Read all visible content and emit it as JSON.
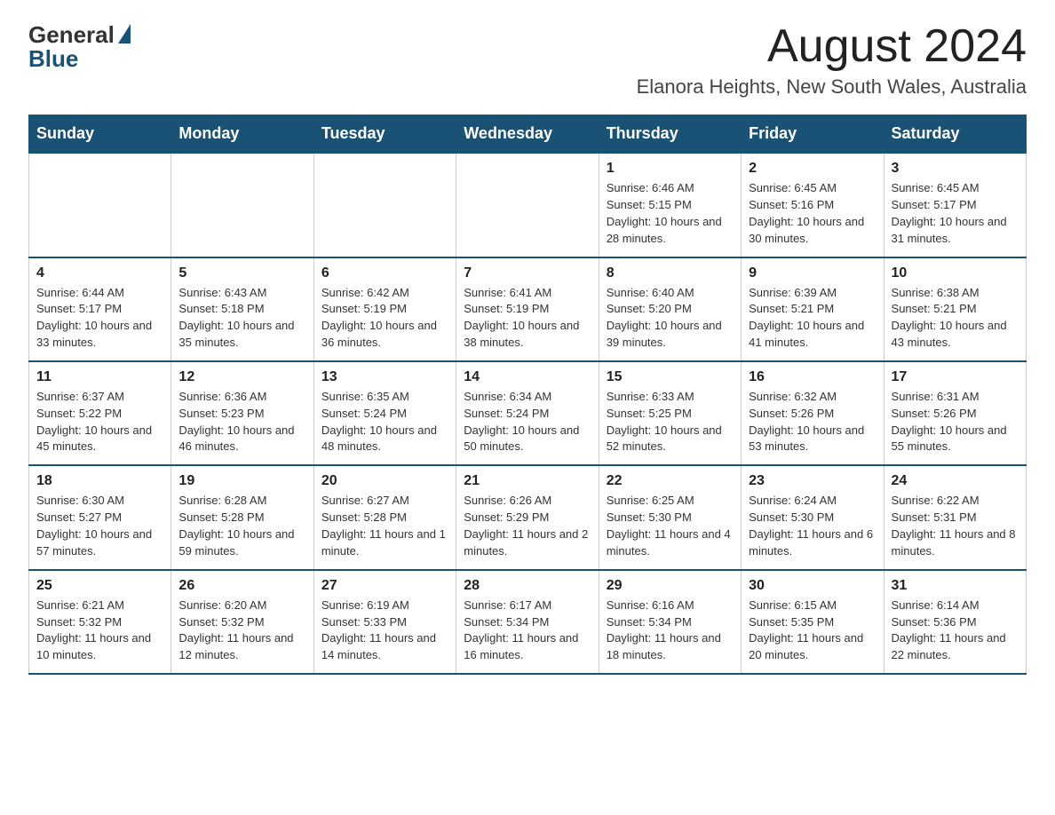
{
  "header": {
    "logo_general": "General",
    "logo_blue": "Blue",
    "month_title": "August 2024",
    "location": "Elanora Heights, New South Wales, Australia"
  },
  "days_of_week": [
    "Sunday",
    "Monday",
    "Tuesday",
    "Wednesday",
    "Thursday",
    "Friday",
    "Saturday"
  ],
  "weeks": [
    [
      {
        "day": "",
        "info": ""
      },
      {
        "day": "",
        "info": ""
      },
      {
        "day": "",
        "info": ""
      },
      {
        "day": "",
        "info": ""
      },
      {
        "day": "1",
        "info": "Sunrise: 6:46 AM\nSunset: 5:15 PM\nDaylight: 10 hours and 28 minutes."
      },
      {
        "day": "2",
        "info": "Sunrise: 6:45 AM\nSunset: 5:16 PM\nDaylight: 10 hours and 30 minutes."
      },
      {
        "day": "3",
        "info": "Sunrise: 6:45 AM\nSunset: 5:17 PM\nDaylight: 10 hours and 31 minutes."
      }
    ],
    [
      {
        "day": "4",
        "info": "Sunrise: 6:44 AM\nSunset: 5:17 PM\nDaylight: 10 hours and 33 minutes."
      },
      {
        "day": "5",
        "info": "Sunrise: 6:43 AM\nSunset: 5:18 PM\nDaylight: 10 hours and 35 minutes."
      },
      {
        "day": "6",
        "info": "Sunrise: 6:42 AM\nSunset: 5:19 PM\nDaylight: 10 hours and 36 minutes."
      },
      {
        "day": "7",
        "info": "Sunrise: 6:41 AM\nSunset: 5:19 PM\nDaylight: 10 hours and 38 minutes."
      },
      {
        "day": "8",
        "info": "Sunrise: 6:40 AM\nSunset: 5:20 PM\nDaylight: 10 hours and 39 minutes."
      },
      {
        "day": "9",
        "info": "Sunrise: 6:39 AM\nSunset: 5:21 PM\nDaylight: 10 hours and 41 minutes."
      },
      {
        "day": "10",
        "info": "Sunrise: 6:38 AM\nSunset: 5:21 PM\nDaylight: 10 hours and 43 minutes."
      }
    ],
    [
      {
        "day": "11",
        "info": "Sunrise: 6:37 AM\nSunset: 5:22 PM\nDaylight: 10 hours and 45 minutes."
      },
      {
        "day": "12",
        "info": "Sunrise: 6:36 AM\nSunset: 5:23 PM\nDaylight: 10 hours and 46 minutes."
      },
      {
        "day": "13",
        "info": "Sunrise: 6:35 AM\nSunset: 5:24 PM\nDaylight: 10 hours and 48 minutes."
      },
      {
        "day": "14",
        "info": "Sunrise: 6:34 AM\nSunset: 5:24 PM\nDaylight: 10 hours and 50 minutes."
      },
      {
        "day": "15",
        "info": "Sunrise: 6:33 AM\nSunset: 5:25 PM\nDaylight: 10 hours and 52 minutes."
      },
      {
        "day": "16",
        "info": "Sunrise: 6:32 AM\nSunset: 5:26 PM\nDaylight: 10 hours and 53 minutes."
      },
      {
        "day": "17",
        "info": "Sunrise: 6:31 AM\nSunset: 5:26 PM\nDaylight: 10 hours and 55 minutes."
      }
    ],
    [
      {
        "day": "18",
        "info": "Sunrise: 6:30 AM\nSunset: 5:27 PM\nDaylight: 10 hours and 57 minutes."
      },
      {
        "day": "19",
        "info": "Sunrise: 6:28 AM\nSunset: 5:28 PM\nDaylight: 10 hours and 59 minutes."
      },
      {
        "day": "20",
        "info": "Sunrise: 6:27 AM\nSunset: 5:28 PM\nDaylight: 11 hours and 1 minute."
      },
      {
        "day": "21",
        "info": "Sunrise: 6:26 AM\nSunset: 5:29 PM\nDaylight: 11 hours and 2 minutes."
      },
      {
        "day": "22",
        "info": "Sunrise: 6:25 AM\nSunset: 5:30 PM\nDaylight: 11 hours and 4 minutes."
      },
      {
        "day": "23",
        "info": "Sunrise: 6:24 AM\nSunset: 5:30 PM\nDaylight: 11 hours and 6 minutes."
      },
      {
        "day": "24",
        "info": "Sunrise: 6:22 AM\nSunset: 5:31 PM\nDaylight: 11 hours and 8 minutes."
      }
    ],
    [
      {
        "day": "25",
        "info": "Sunrise: 6:21 AM\nSunset: 5:32 PM\nDaylight: 11 hours and 10 minutes."
      },
      {
        "day": "26",
        "info": "Sunrise: 6:20 AM\nSunset: 5:32 PM\nDaylight: 11 hours and 12 minutes."
      },
      {
        "day": "27",
        "info": "Sunrise: 6:19 AM\nSunset: 5:33 PM\nDaylight: 11 hours and 14 minutes."
      },
      {
        "day": "28",
        "info": "Sunrise: 6:17 AM\nSunset: 5:34 PM\nDaylight: 11 hours and 16 minutes."
      },
      {
        "day": "29",
        "info": "Sunrise: 6:16 AM\nSunset: 5:34 PM\nDaylight: 11 hours and 18 minutes."
      },
      {
        "day": "30",
        "info": "Sunrise: 6:15 AM\nSunset: 5:35 PM\nDaylight: 11 hours and 20 minutes."
      },
      {
        "day": "31",
        "info": "Sunrise: 6:14 AM\nSunset: 5:36 PM\nDaylight: 11 hours and 22 minutes."
      }
    ]
  ]
}
